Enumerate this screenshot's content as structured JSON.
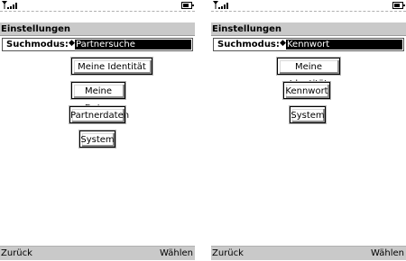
{
  "left_screen": {
    "title": "Einstellungen",
    "search_label": "Suchmodus:",
    "search_value": "Partnersuche",
    "menu": [
      {
        "label": "Meine Identität"
      },
      {
        "label": "Meine Daten"
      },
      {
        "label": "Partnerdaten"
      },
      {
        "label": "System"
      }
    ],
    "softkey_left": "Zurück",
    "softkey_right": "Wählen"
  },
  "right_screen": {
    "title": "Einstellungen",
    "search_label": "Suchmodus:",
    "search_value": "Kennwort",
    "menu": [
      {
        "label": "Meine Identität"
      },
      {
        "label": "Kennwort"
      },
      {
        "label": "System"
      }
    ],
    "softkey_left": "Zurück",
    "softkey_right": "Wählen"
  }
}
